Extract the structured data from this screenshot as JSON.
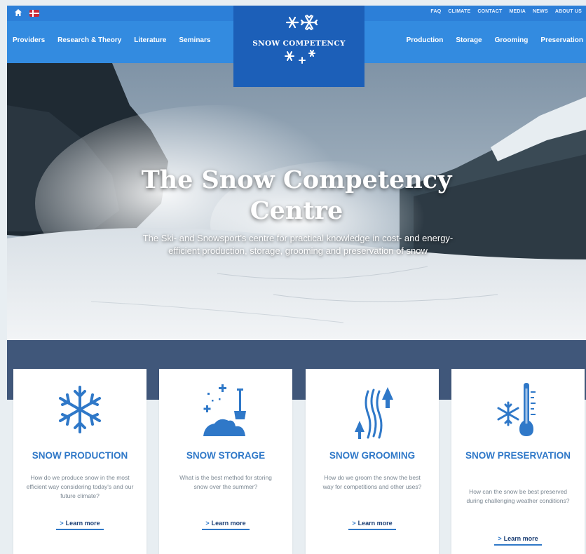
{
  "colors": {
    "topbar": "#2c7fd8",
    "navbar": "#338be0",
    "logo": "#1c5fb8",
    "accent": "#2f78c8",
    "band": "#40577a"
  },
  "topbar": {
    "links": [
      "FAQ",
      "CLIMATE",
      "CONTACT",
      "MEDIA",
      "NEWS",
      "ABOUT US"
    ]
  },
  "nav": {
    "left": [
      "Providers",
      "Research & Theory",
      "Literature",
      "Seminars"
    ],
    "right": [
      "Production",
      "Storage",
      "Grooming",
      "Preservation"
    ]
  },
  "logo": {
    "text": "SNOW COMPETENCY"
  },
  "hero": {
    "title_line1": "The Snow Competency",
    "title_line2": "Centre",
    "subtitle": "The Ski- and Snowsport's centre for practical knowledge in cost- and energy-efficient production, storage, grooming and preservation of snow"
  },
  "cards": [
    {
      "icon": "snowflake-icon",
      "title": "SNOW PRODUCTION",
      "description": "How do we produce snow in the most efficient way considering today's and our future climate?",
      "link": "Learn more"
    },
    {
      "icon": "snow-storage-icon",
      "title": "SNOW STORAGE",
      "description": "What is the best method for storing snow over the summer?",
      "link": "Learn more"
    },
    {
      "icon": "snow-grooming-icon",
      "title": "SNOW GROOMING",
      "description": "How do we groom the snow the best way for competitions and other uses?",
      "link": "Learn more"
    },
    {
      "icon": "snow-preservation-icon",
      "title": "SNOW PRESERVATION",
      "description": "How can the snow be best preserved during challenging weather conditions?",
      "link": "Learn more"
    }
  ]
}
